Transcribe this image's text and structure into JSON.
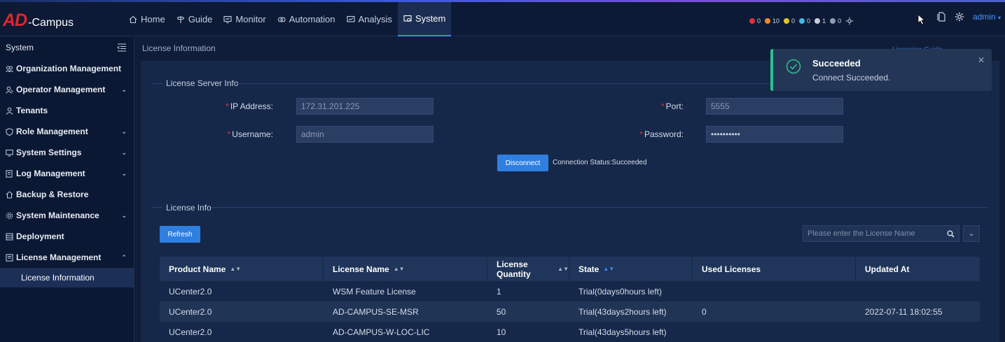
{
  "brand": {
    "logo_ad": "AD",
    "logo_campus": "-Campus"
  },
  "nav": [
    {
      "label": "Home",
      "icon": "home-icon"
    },
    {
      "label": "Guide",
      "icon": "signpost-icon"
    },
    {
      "label": "Monitor",
      "icon": "monitor-icon"
    },
    {
      "label": "Automation",
      "icon": "automation-icon"
    },
    {
      "label": "Analysis",
      "icon": "analysis-icon"
    },
    {
      "label": "System",
      "icon": "system-icon",
      "active": true
    }
  ],
  "alarms": [
    {
      "count": "0",
      "color": "#e0313a"
    },
    {
      "count": "10",
      "color": "#f08a24"
    },
    {
      "count": "0",
      "color": "#e6c229"
    },
    {
      "count": "0",
      "color": "#3fb8e8"
    },
    {
      "count": "1",
      "color": "#c7ced9"
    },
    {
      "count": "0",
      "color": "#8f9bb0"
    }
  ],
  "user": {
    "name": "admin"
  },
  "sidebar": {
    "title": "System",
    "items": [
      {
        "label": "Organization Management",
        "icon": "organization-icon",
        "chevron": false
      },
      {
        "label": "Operator Management",
        "icon": "operator-icon",
        "chevron": true
      },
      {
        "label": "Tenants",
        "icon": "tenant-icon",
        "chevron": false
      },
      {
        "label": "Role Management",
        "icon": "shield-icon",
        "chevron": true
      },
      {
        "label": "System Settings",
        "icon": "settings-icon",
        "chevron": true
      },
      {
        "label": "Log Management",
        "icon": "log-icon",
        "chevron": true
      },
      {
        "label": "Backup & Restore",
        "icon": "backup-icon",
        "chevron": false
      },
      {
        "label": "System Maintenance",
        "icon": "maintenance-icon",
        "chevron": true
      },
      {
        "label": "Deployment",
        "icon": "deployment-icon",
        "chevron": false
      },
      {
        "label": "License Management",
        "icon": "license-icon",
        "chevron": true,
        "expanded": true
      }
    ],
    "sub_item": "License Information"
  },
  "page": {
    "breadcrumb": "License Information",
    "guide_link": "Licensing Guide"
  },
  "server_info": {
    "title": "License Server Info",
    "ip_label": "IP Address",
    "ip_value": "172.31.201.225",
    "port_label": "Port",
    "port_value": "5555",
    "username_label": "Username",
    "username_value": "admin",
    "password_label": "Password",
    "password_value": "••••••••••",
    "disconnect_label": "Disconnect",
    "connection_status": "Connection Status:Succeeded"
  },
  "license_info": {
    "title": "License Info",
    "refresh_label": "Refresh",
    "search_placeholder": "Please enter the License Name",
    "columns": [
      "Product Name",
      "License Name",
      "License Quantity",
      "State",
      "Used Licenses",
      "Updated At"
    ],
    "rows": [
      [
        "UCenter2.0",
        "WSM Feature License",
        "1",
        "Trial(0days0hours left)",
        "",
        ""
      ],
      [
        "UCenter2.0",
        "AD-CAMPUS-SE-MSR",
        "50",
        "Trial(43days2hours left)",
        "0",
        "2022-07-11 18:02:55"
      ],
      [
        "UCenter2.0",
        "AD-CAMPUS-W-LOC-LIC",
        "10",
        "Trial(43days5hours left)",
        "",
        ""
      ]
    ]
  },
  "toast": {
    "title": "Succeeded",
    "message": "Connect Succeeded.",
    "accent": "#2fbf8d"
  }
}
